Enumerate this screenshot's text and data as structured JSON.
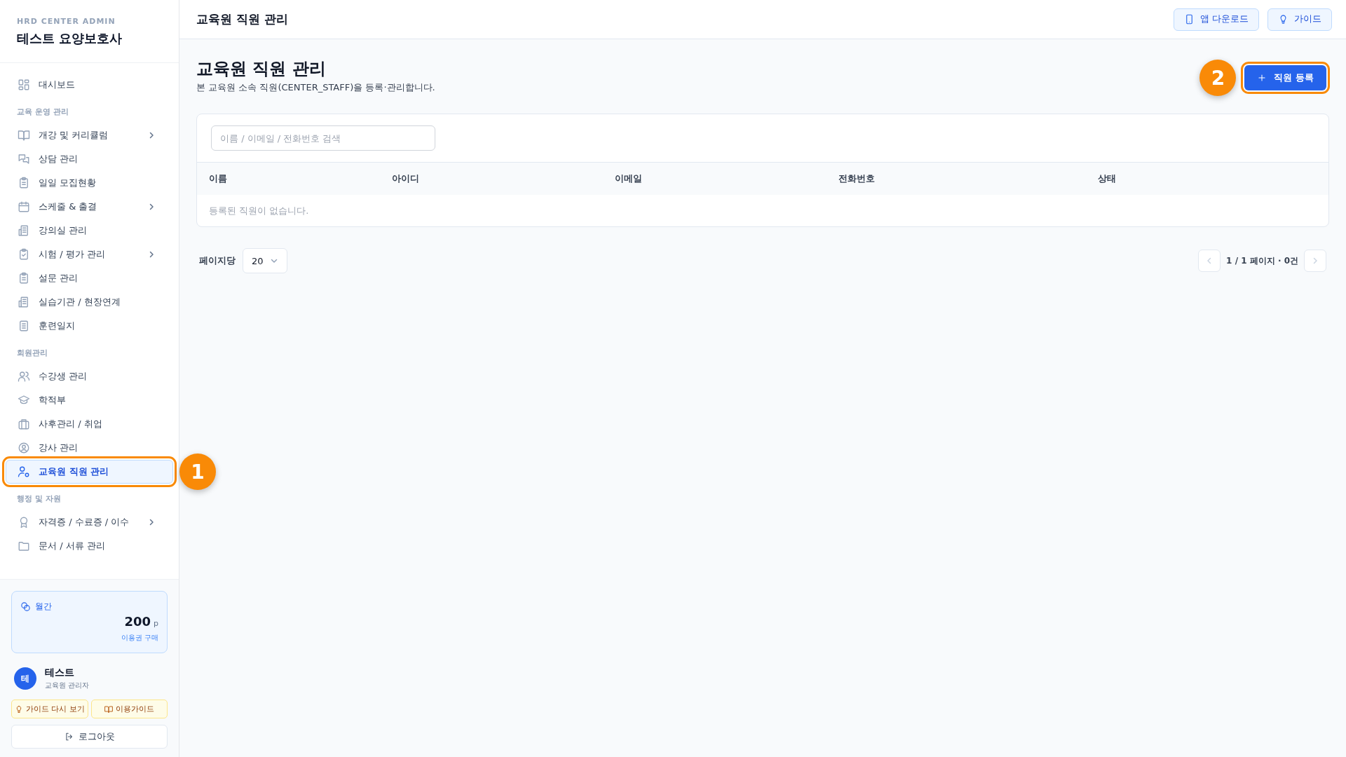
{
  "brand": {
    "label": "HRD CENTER ADMIN",
    "name": "테스트 요양보호사"
  },
  "nav": [
    {
      "kind": "item",
      "label": "대시보드",
      "selected": false,
      "expandable": false
    },
    {
      "kind": "section",
      "label": "교육 운영 관리"
    },
    {
      "kind": "item",
      "label": "개강 및 커리큘럼",
      "selected": false,
      "expandable": true
    },
    {
      "kind": "item",
      "label": "상담 관리",
      "selected": false,
      "expandable": false
    },
    {
      "kind": "item",
      "label": "일일 모집현황",
      "selected": false,
      "expandable": false
    },
    {
      "kind": "item",
      "label": "스케줄 & 출결",
      "selected": false,
      "expandable": true
    },
    {
      "kind": "item",
      "label": "강의실 관리",
      "selected": false,
      "expandable": false
    },
    {
      "kind": "item",
      "label": "시험 / 평가 관리",
      "selected": false,
      "expandable": true
    },
    {
      "kind": "item",
      "label": "설문 관리",
      "selected": false,
      "expandable": false
    },
    {
      "kind": "item",
      "label": "실습기관 / 현장연계",
      "selected": false,
      "expandable": false
    },
    {
      "kind": "item",
      "label": "훈련일지",
      "selected": false,
      "expandable": false
    },
    {
      "kind": "section",
      "label": "회원관리"
    },
    {
      "kind": "item",
      "label": "수강생 관리",
      "selected": false,
      "expandable": false
    },
    {
      "kind": "item",
      "label": "학적부",
      "selected": false,
      "expandable": false
    },
    {
      "kind": "item",
      "label": "사후관리 / 취업",
      "selected": false,
      "expandable": false
    },
    {
      "kind": "item",
      "label": "강사 관리",
      "selected": false,
      "expandable": false
    },
    {
      "kind": "item",
      "label": "교육원 직원 관리",
      "selected": true,
      "expandable": false,
      "highlighted": true,
      "callout": "1"
    },
    {
      "kind": "section",
      "label": "행정 및 자원"
    },
    {
      "kind": "item",
      "label": "자격증 / 수료증 / 이수",
      "selected": false,
      "expandable": true
    },
    {
      "kind": "item",
      "label": "문서 / 서류 관리",
      "selected": false,
      "expandable": false
    }
  ],
  "points": {
    "label": "월간",
    "amount": "200",
    "unit": "p",
    "link": "이용권 구매"
  },
  "user": {
    "avatar": "테",
    "name": "테스트",
    "role": "교육원 관리자"
  },
  "sidebar_buttons": [
    "가이드 다시 보기",
    "이용가이드"
  ],
  "logout": "로그아웃",
  "header": {
    "title": "교육원 직원 관리",
    "buttons": [
      "앱 다운로드",
      "가이드"
    ]
  },
  "page": {
    "title": "교육원 직원 관리",
    "description": "본 교육원 소속 직원(CENTER_STAFF)을 등록·관리합니다.",
    "primary_button": {
      "label": "직원 등록",
      "highlighted": true,
      "callout": "2"
    }
  },
  "search": {
    "placeholder": "이름 / 이메일 / 전화번호 검색"
  },
  "table": {
    "columns": [
      "이름",
      "아이디",
      "이메일",
      "전화번호",
      "상태"
    ],
    "empty_message": "등록된 직원이 없습니다."
  },
  "pagination": {
    "per_page_label": "페이지당",
    "per_page": "20",
    "info": "1 / 1 페이지 · 0건",
    "prev_disabled": true,
    "next_disabled": true
  }
}
